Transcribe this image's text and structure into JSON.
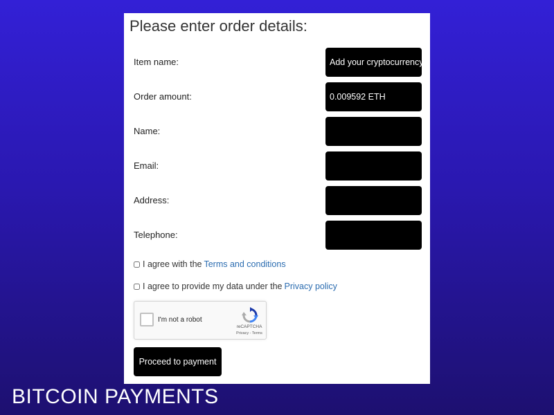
{
  "form": {
    "title": "Please enter order details:",
    "fields": [
      {
        "label": "Item name:",
        "value": "Add your cryptocurrency"
      },
      {
        "label": "Order amount:",
        "value": "0.009592 ETH"
      },
      {
        "label": "Name:",
        "value": ""
      },
      {
        "label": "Email:",
        "value": ""
      },
      {
        "label": "Address:",
        "value": ""
      },
      {
        "label": "Telephone:",
        "value": ""
      }
    ],
    "terms": {
      "text": "I agree with the",
      "link": "Terms and conditions",
      "checked": false
    },
    "privacy": {
      "text": "I agree to provide my data under the",
      "link": "Privacy policy",
      "checked": false
    },
    "recaptcha": {
      "label": "I'm not a robot",
      "brand": "reCAPTCHA",
      "links": "Privacy - Terms",
      "checked": false
    },
    "submit_label": "Proceed to payment"
  },
  "caption": "BITCOIN PAYMENTS",
  "colors": {
    "background_top": "#3320d6",
    "background_bottom": "#1d1070",
    "field_bg": "#000000",
    "link": "#2b6cb0"
  }
}
